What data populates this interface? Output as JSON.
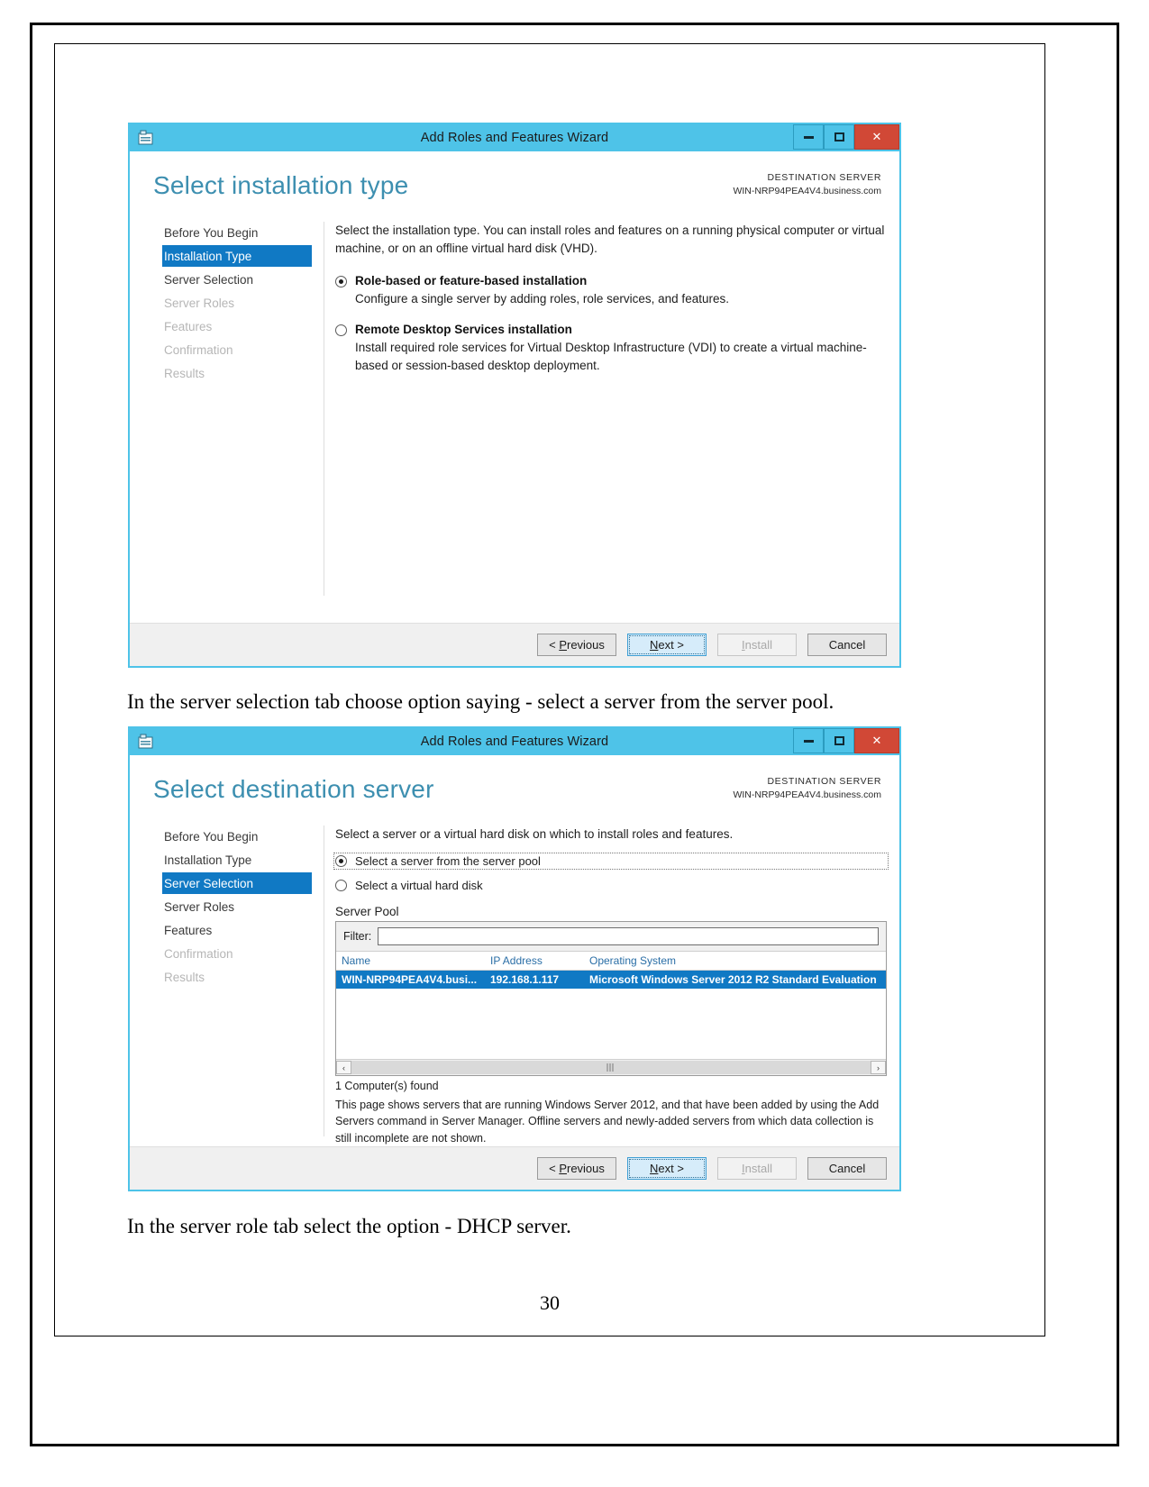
{
  "document": {
    "page_number": "30",
    "caption_1": "In the server selection tab choose option saying - select a server from the server pool.",
    "caption_2": "In the server role tab select the option - DHCP server."
  },
  "wizard1": {
    "titlebar": {
      "title": "Add Roles and Features Wizard",
      "icon": "wizard-app-icon",
      "minimize": "–",
      "maximize": "□",
      "close": "✕"
    },
    "heading": "Select installation type",
    "destination": {
      "label": "DESTINATION SERVER",
      "value": "WIN-NRP94PEA4V4.business.com"
    },
    "nav": [
      {
        "label": "Before You Begin",
        "state": "normal"
      },
      {
        "label": "Installation Type",
        "state": "active"
      },
      {
        "label": "Server Selection",
        "state": "normal"
      },
      {
        "label": "Server Roles",
        "state": "dim"
      },
      {
        "label": "Features",
        "state": "dim"
      },
      {
        "label": "Confirmation",
        "state": "dim"
      },
      {
        "label": "Results",
        "state": "dim"
      }
    ],
    "intro": "Select the installation type. You can install roles and features on a running physical computer or virtual machine, or on an offline virtual hard disk (VHD).",
    "options": [
      {
        "title": "Role-based or feature-based installation",
        "desc": "Configure a single server by adding roles, role services, and features.",
        "selected": true
      },
      {
        "title": "Remote Desktop Services installation",
        "desc": "Install required role services for Virtual Desktop Infrastructure (VDI) to create a virtual machine-based or session-based desktop deployment.",
        "selected": false
      }
    ],
    "footer": {
      "previous": "< Previous",
      "next": "Next >",
      "install": "Install",
      "cancel": "Cancel"
    }
  },
  "wizard2": {
    "titlebar": {
      "title": "Add Roles and Features Wizard",
      "icon": "wizard-app-icon",
      "minimize": "–",
      "maximize": "□",
      "close": "✕"
    },
    "heading": "Select destination server",
    "destination": {
      "label": "DESTINATION SERVER",
      "value": "WIN-NRP94PEA4V4.business.com"
    },
    "nav": [
      {
        "label": "Before You Begin",
        "state": "normal"
      },
      {
        "label": "Installation Type",
        "state": "normal"
      },
      {
        "label": "Server Selection",
        "state": "active"
      },
      {
        "label": "Server Roles",
        "state": "normal"
      },
      {
        "label": "Features",
        "state": "normal"
      },
      {
        "label": "Confirmation",
        "state": "dim"
      },
      {
        "label": "Results",
        "state": "dim"
      }
    ],
    "intro": "Select a server or a virtual hard disk on which to install roles and features.",
    "options": [
      {
        "label": "Select a server from the server pool",
        "selected": true
      },
      {
        "label": "Select a virtual hard disk",
        "selected": false
      }
    ],
    "server_pool": {
      "group_label": "Server Pool",
      "filter_label": "Filter:",
      "filter_value": "",
      "filter_placeholder": "",
      "columns": [
        "Name",
        "IP Address",
        "Operating System"
      ],
      "rows": [
        {
          "name": "WIN-NRP94PEA4V4.busi...",
          "ip": "192.168.1.117",
          "os": "Microsoft Windows Server 2012 R2 Standard Evaluation",
          "selected": true
        }
      ],
      "scroll_left": "‹",
      "scroll_right": "›"
    },
    "found_text": "1 Computer(s) found",
    "note_text": "This page shows servers that are running Windows Server 2012, and that have been added by using the Add Servers command in Server Manager. Offline servers and newly-added servers from which data collection is still incomplete are not shown.",
    "footer": {
      "previous": "< Previous",
      "next": "Next >",
      "install": "Install",
      "cancel": "Cancel"
    }
  }
}
